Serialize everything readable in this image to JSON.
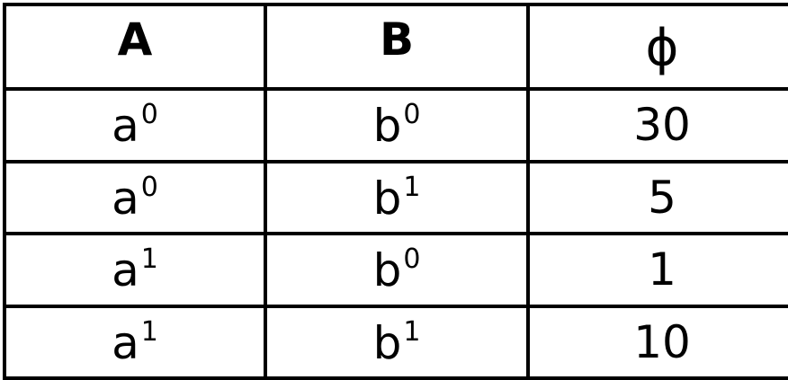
{
  "table": {
    "headers": [
      "A",
      "B",
      "ϕ"
    ],
    "rows": [
      {
        "a": {
          "base": "a",
          "sup": "0"
        },
        "b": {
          "base": "b",
          "sup": "0"
        },
        "phi": "30"
      },
      {
        "a": {
          "base": "a",
          "sup": "0"
        },
        "b": {
          "base": "b",
          "sup": "1"
        },
        "phi": "5"
      },
      {
        "a": {
          "base": "a",
          "sup": "1"
        },
        "b": {
          "base": "b",
          "sup": "0"
        },
        "phi": "1"
      },
      {
        "a": {
          "base": "a",
          "sup": "1"
        },
        "b": {
          "base": "b",
          "sup": "1"
        },
        "phi": "10"
      }
    ]
  }
}
